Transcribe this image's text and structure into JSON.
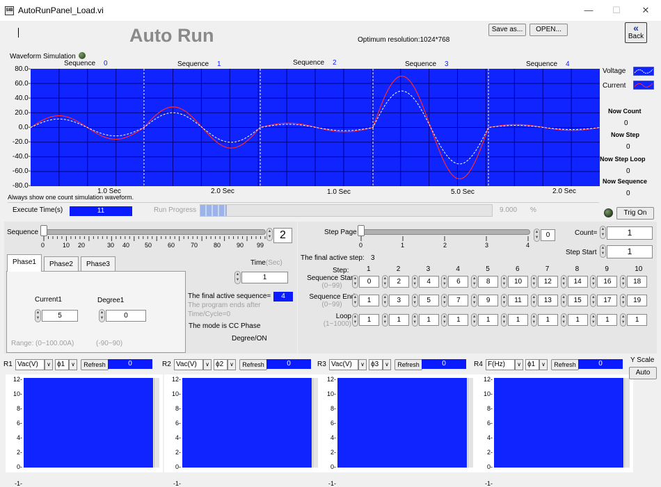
{
  "window": {
    "title": "AutoRunPanel_Load.vi",
    "icon_text": "SIB",
    "minimize": "—",
    "maximize": "☐",
    "close": "✕"
  },
  "header": {
    "title": "Auto Run",
    "resolution": "Optimum resolution:1024*768",
    "save_label": "Save as...",
    "open_label": "OPEN...",
    "back_label": "Back",
    "back_icon": "«"
  },
  "waveform": {
    "label": "Waveform Simulation",
    "note": "Always show one count simulation waveform.",
    "y_ticks": [
      "80.0-",
      "60.0-",
      "40.0-",
      "20.0-",
      "0.0-",
      "-20.0-",
      "-40.0-",
      "-60.0-",
      "-80.0-"
    ],
    "sequences": [
      {
        "label": "Sequence",
        "num": "0"
      },
      {
        "label": "Sequence",
        "num": "1"
      },
      {
        "label": "Sequence",
        "num": "2"
      },
      {
        "label": "Sequence",
        "num": "3"
      },
      {
        "label": "Sequence",
        "num": "4"
      }
    ],
    "x_ticks": [
      "1.0 Sec",
      "2.0 Sec",
      "1.0 Sec",
      "5.0 Sec",
      "2.0 Sec"
    ],
    "legend": [
      {
        "name": "Voltage",
        "color": "#ffffff"
      },
      {
        "name": "Current",
        "color": "#ff2a2a"
      }
    ],
    "colors": {
      "background": "#0f24ff",
      "grid": "#00008a",
      "divider": "#ffffff"
    }
  },
  "stats": [
    {
      "label": "Now Count",
      "value": "0"
    },
    {
      "label": "Now Step",
      "value": "0"
    },
    {
      "label": "Now Step Loop",
      "value": "0"
    },
    {
      "label": "Now Sequence",
      "value": "0"
    }
  ],
  "execute": {
    "label": "Execute Time(s)",
    "value": "11"
  },
  "progress": {
    "label": "Run Progress",
    "value": "9.000",
    "unit": "%",
    "fraction": 0.09
  },
  "trig": {
    "label": "Trig On"
  },
  "sequence_slider": {
    "label": "Sequence",
    "value": "2",
    "ticks": [
      "0",
      "10",
      "20",
      "30",
      "40",
      "50",
      "60",
      "70",
      "80",
      "90",
      "99"
    ]
  },
  "phase_tabs": [
    "Phase1",
    "Phase2",
    "Phase3"
  ],
  "phase": {
    "current_label": "Current1",
    "current_value": "5",
    "degree_label": "Degree1",
    "degree_value": "0",
    "current_range": "Range:  (0~100.00A)",
    "degree_range": "(-90~90)"
  },
  "time": {
    "label": "Time",
    "unit": "(Sec)",
    "value": "1"
  },
  "final_seq": {
    "label": "The final active sequence=",
    "value": "4",
    "note_line1": "The program ends after",
    "note_line2": "Time/Cycle=0"
  },
  "mode": {
    "line1": "The mode is CC Phase",
    "line2": "Degree/ON"
  },
  "step_page": {
    "label": "Step Page",
    "value": "0",
    "ticks": [
      "0",
      "1",
      "2",
      "3",
      "4"
    ]
  },
  "count": {
    "label": "Count=",
    "value": "1"
  },
  "step_start": {
    "label": "Step Start",
    "value": "1"
  },
  "final_step": {
    "label": "The final active step:",
    "value": "3"
  },
  "steps": {
    "header_label": "Step:",
    "numbers": [
      "1",
      "2",
      "3",
      "4",
      "5",
      "6",
      "7",
      "8",
      "9",
      "10"
    ],
    "rows": [
      {
        "label": "Sequence Start",
        "range": "(0~99)",
        "values": [
          "0",
          "2",
          "4",
          "6",
          "8",
          "10",
          "12",
          "14",
          "16",
          "18"
        ]
      },
      {
        "label": "Sequence End",
        "range": "(0~99)",
        "values": [
          "1",
          "3",
          "5",
          "7",
          "9",
          "11",
          "13",
          "15",
          "17",
          "19"
        ]
      },
      {
        "label": "Loop",
        "range": "(1~1000)",
        "values": [
          "1",
          "1",
          "1",
          "1",
          "1",
          "1",
          "1",
          "1",
          "1",
          "1"
        ]
      }
    ]
  },
  "monitors": [
    {
      "name": "R1",
      "measure": "Vac(V)",
      "phase": "ϕ1",
      "refresh": "Refresh",
      "value": "0"
    },
    {
      "name": "R2",
      "measure": "Vac(V)",
      "phase": "ϕ2",
      "refresh": "Refresh",
      "value": "0"
    },
    {
      "name": "R3",
      "measure": "Vac(V)",
      "phase": "ϕ3",
      "refresh": "Refresh",
      "value": "0"
    },
    {
      "name": "R4",
      "measure": "F(Hz)",
      "phase": "ϕ1",
      "refresh": "Refresh",
      "value": "0"
    }
  ],
  "monitor_y_ticks": [
    "12-",
    "10-",
    "8-",
    "6-",
    "4-",
    "2-",
    "0-",
    "-1-"
  ],
  "yscale": {
    "label": "Y Scale",
    "button": "Auto"
  }
}
